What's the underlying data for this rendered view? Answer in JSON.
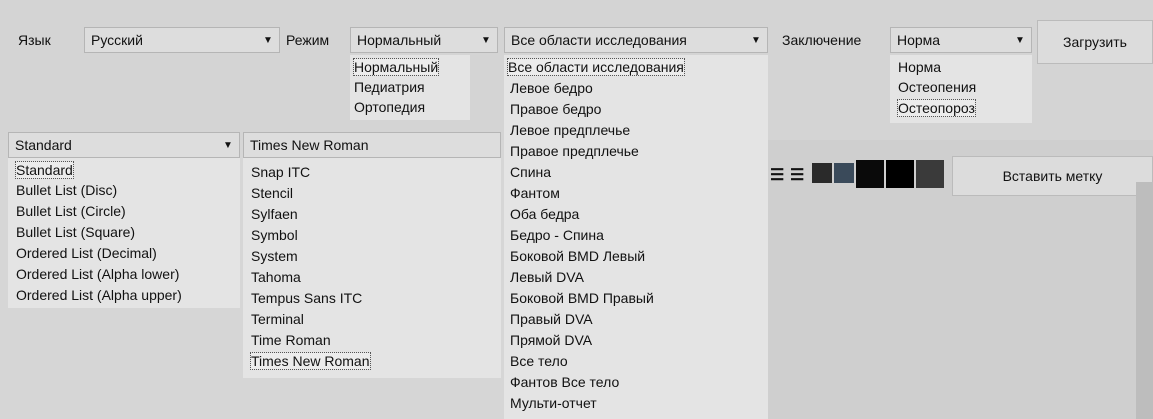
{
  "toolbar": {
    "language_label": "Язык",
    "language_value": "Русский",
    "mode_label": "Режим",
    "mode_value": "Нормальный",
    "mode_options": [
      "Нормальный",
      "Педиатрия",
      "Ортопедия"
    ],
    "area_value": "Все области исследования",
    "area_options": [
      "Все области исследования",
      "Левое бедро",
      "Правое бедро",
      "Левое предплечье",
      "Правое предплечье",
      "Спина",
      "Фантом",
      "Оба бедра",
      "Бедро - Спина",
      "Боковой BMD Левый",
      "Левый DVA",
      "Боковой BMD Правый",
      "Правый DVA",
      "Прямой DVA",
      "Все тело",
      "Фантов Все тело",
      "Мульти-отчет"
    ],
    "conclusion_label": "Заключение",
    "conclusion_value": "Норма",
    "conclusion_options": [
      "Норма",
      "Остеопения",
      "Остеопороз"
    ],
    "load_button": "Загрузить"
  },
  "editor": {
    "style_value": "Standard",
    "style_options": [
      "Standard",
      "Bullet List (Disc)",
      "Bullet List (Circle)",
      "Bullet List (Square)",
      "Ordered List (Decimal)",
      "Ordered List (Alpha lower)",
      "Ordered List (Alpha upper)"
    ],
    "font_value": "Times New Roman",
    "font_options": [
      "Snap ITC",
      "Stencil",
      "Sylfaen",
      "Symbol",
      "System",
      "Tahoma",
      "Tempus Sans ITC",
      "Terminal",
      "Time Roman",
      "Times New Roman"
    ],
    "insert_mark_button": "Вставить метку",
    "palette_colors": [
      "#2a2a2a",
      "#3a4a5a",
      "#0a0a0a",
      "#000000",
      "#3a3a3a"
    ]
  }
}
